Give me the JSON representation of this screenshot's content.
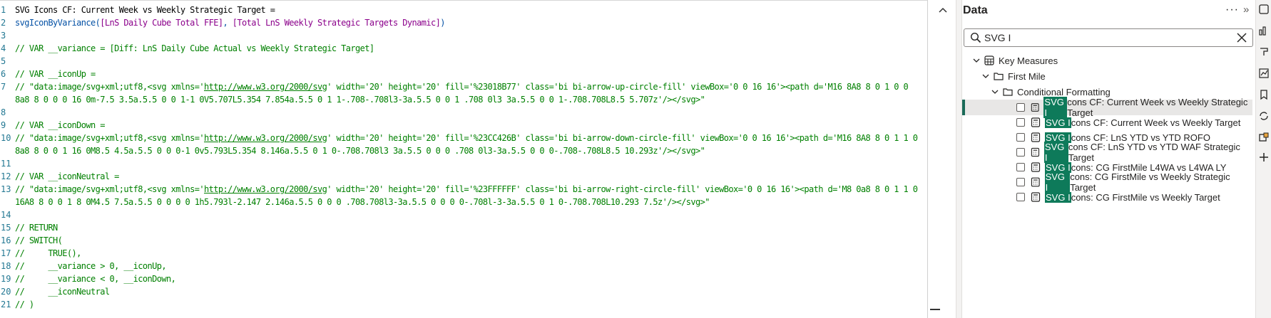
{
  "editor": {
    "line_numbers": [
      "1",
      "2",
      "3",
      "4",
      "5",
      "6",
      "7",
      "8",
      "9",
      "10",
      "11",
      "12",
      "13",
      "14",
      "15",
      "16",
      "17",
      "18",
      "19",
      "20",
      "21"
    ],
    "lines": [
      {
        "cls": "",
        "text": "SVG Icons CF: Current Week vs Weekly Strategic Target ="
      },
      {
        "cls": "mixed",
        "parts": [
          {
            "cls": "c-fn",
            "text": "svgIconByVariance("
          },
          {
            "cls": "c-ref",
            "text": "[LnS Daily Cube Total FFE]"
          },
          {
            "cls": "c-fn",
            "text": ", "
          },
          {
            "cls": "c-ref",
            "text": "[Total LnS Weekly Strategic Targets Dynamic]"
          },
          {
            "cls": "c-fn",
            "text": ")"
          }
        ]
      },
      {
        "cls": "",
        "text": ""
      },
      {
        "cls": "c-comment",
        "text": "// VAR __variance = [Diff: LnS Daily Cube Actual vs Weekly Strategic Target]"
      },
      {
        "cls": "",
        "text": ""
      },
      {
        "cls": "c-comment",
        "text": "// VAR __iconUp ="
      },
      {
        "cls": "c-comment",
        "url": "http://www.w3.org/2000/svg",
        "before": "// \"data:image/svg+xml;utf8,<svg xmlns='",
        "after": "' width='20' height='20' fill='%23018B77' class='bi bi-arrow-up-circle-fill' viewBox='0 0 16 16'><path d='M16 8A8 8 0 1 0 0"
      },
      {
        "cls": "c-comment",
        "text": "8a8 8 0 0 0 16 0m-7.5 3.5a.5.5 0 0 1-1 0V5.707L5.354 7.854a.5.5 0 1 1-.708-.708l3-3a.5.5 0 0 1 .708 0l3 3a.5.5 0 0 1-.708.708L8.5 5.707z'/></svg>\""
      },
      {
        "cls": "",
        "text": ""
      },
      {
        "cls": "c-comment",
        "text": "// VAR __iconDown ="
      },
      {
        "cls": "c-comment",
        "url": "http://www.w3.org/2000/svg",
        "before": "// \"data:image/svg+xml;utf8,<svg xmlns='",
        "after": "' width='20' height='20' fill='%23CC426B' class='bi bi-arrow-down-circle-fill' viewBox='0 0 16 16'><path d='M16 8A8 8 0 1 1 0"
      },
      {
        "cls": "c-comment",
        "text": "8a8 8 0 0 1 16 0M8.5 4.5a.5.5 0 0 0-1 0v5.793L5.354 8.146a.5.5 0 1 0-.708.708l3 3a.5.5 0 0 0 .708 0l3-3a.5.5 0 0 0-.708-.708L8.5 10.293z'/></svg>\""
      },
      {
        "cls": "",
        "text": ""
      },
      {
        "cls": "c-comment",
        "text": "// VAR __iconNeutral ="
      },
      {
        "cls": "c-comment",
        "url": "http://www.w3.org/2000/svg",
        "before": "// \"data:image/svg+xml;utf8,<svg xmlns='",
        "after": "' width='20' height='20' fill='%23FFFFFF' class='bi bi-arrow-right-circle-fill' viewBox='0 0 16 16'><path d='M8 0a8 8 0 1 1 0"
      },
      {
        "cls": "c-comment",
        "text": "16A8 8 0 0 1 8 0M4.5 7.5a.5.5 0 0 0 0 1h5.793l-2.147 2.146a.5.5 0 0 0 .708.708l3-3a.5.5 0 0 0 0-.708l-3-3a.5.5 0 1 0-.708.708L10.293 7.5z'/></svg>\""
      },
      {
        "cls": "",
        "text": ""
      },
      {
        "cls": "c-comment",
        "text": "// RETURN"
      },
      {
        "cls": "c-comment",
        "text": "// SWITCH("
      },
      {
        "cls": "c-comment",
        "text": "//     TRUE(),"
      },
      {
        "cls": "c-comment",
        "text": "//     __variance > 0, __iconUp,"
      },
      {
        "cls": "c-comment",
        "text": "//     __variance < 0, __iconDown,"
      },
      {
        "cls": "c-comment",
        "text": "//     __iconNeutral"
      },
      {
        "cls": "c-comment",
        "text": "// )"
      }
    ],
    "wrap_line_numbers": [
      "1",
      "2",
      "3",
      "4",
      "5",
      "6",
      "7",
      "",
      "8",
      "9",
      "10",
      "",
      "11",
      "12",
      "13",
      "",
      "14",
      "15",
      "16",
      "17",
      "18",
      "19",
      "20",
      "21"
    ]
  },
  "pane": {
    "title": "Data",
    "more": "···",
    "expand": "»"
  },
  "search": {
    "value": "SVG I"
  },
  "tree": {
    "root": "Key Measures",
    "folder1": "First Mile",
    "folder2": "Conditional Formatting",
    "items": [
      {
        "match": "SVG I",
        "rest": "cons CF: Current Week vs Weekly Strategic Target",
        "selected": true
      },
      {
        "match": "SVG I",
        "rest": "cons CF: Current Week vs Weekly Target",
        "selected": false
      },
      {
        "match": "SVG I",
        "rest": "cons CF: LnS YTD vs YTD ROFO",
        "selected": false
      },
      {
        "match": "SVG I",
        "rest": "cons CF: LnS YTD vs YTD WAF Strategic Target",
        "selected": false
      },
      {
        "match": "SVG I",
        "rest": "cons: CG FirstMile L4WA vs L4WA LY",
        "selected": false
      },
      {
        "match": "SVG I",
        "rest": "cons: CG FirstMile vs Weekly Strategic Target",
        "selected": false
      },
      {
        "match": "SVG I",
        "rest": "cons: CG FirstMile vs Weekly Target",
        "selected": false
      }
    ]
  },
  "colors": {
    "highlight": "#0e7a5a",
    "selection_bar": "#1a6a58",
    "comment": "#008000"
  }
}
